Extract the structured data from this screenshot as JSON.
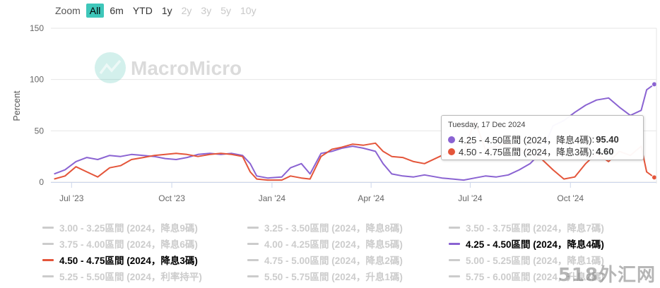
{
  "zoom": {
    "label": "Zoom",
    "buttons": [
      {
        "label": "All",
        "state": "active"
      },
      {
        "label": "6m",
        "state": "normal"
      },
      {
        "label": "YTD",
        "state": "normal"
      },
      {
        "label": "1y",
        "state": "normal"
      },
      {
        "label": "2y",
        "state": "disabled"
      },
      {
        "label": "3y",
        "state": "disabled"
      },
      {
        "label": "5y",
        "state": "disabled"
      },
      {
        "label": "10y",
        "state": "disabled"
      }
    ]
  },
  "watermark": "MacroMicro",
  "corner_watermark": "518外汇网",
  "tooltip": {
    "date": "Tuesday, 17 Dec 2024",
    "rows": [
      {
        "label": "4.25 - 4.50區間 (2024，降息4碼)",
        "value": "95.40",
        "color": "#8a63d2"
      },
      {
        "label": "4.50 - 4.75區間 (2024，降息3碼)",
        "value": "4.60",
        "color": "#e4553a"
      }
    ]
  },
  "legend": [
    {
      "label": "3.00 - 3.25區間 (2024，降息9碼)",
      "visible": false,
      "color": "#cccccc"
    },
    {
      "label": "3.25 - 3.50區間 (2024，降息8碼)",
      "visible": false,
      "color": "#cccccc"
    },
    {
      "label": "3.50 - 3.75區間 (2024，降息7碼)",
      "visible": false,
      "color": "#cccccc"
    },
    {
      "label": "3.75 - 4.00區間 (2024，降息6碼)",
      "visible": false,
      "color": "#cccccc"
    },
    {
      "label": "4.00 - 4.25區間 (2024，降息5碼)",
      "visible": false,
      "color": "#cccccc"
    },
    {
      "label": "4.25 - 4.50區間 (2024，降息4碼)",
      "visible": true,
      "color": "#8a63d2"
    },
    {
      "label": "4.50 - 4.75區間 (2024，降息3碼)",
      "visible": true,
      "color": "#e4553a"
    },
    {
      "label": "4.75 - 5.00區間 (2024，降息2碼)",
      "visible": false,
      "color": "#cccccc"
    },
    {
      "label": "5.00 - 5.25區間 (2024，降息1碼)",
      "visible": false,
      "color": "#cccccc"
    },
    {
      "label": "5.25 - 5.50區間 (2024，利率持平)",
      "visible": false,
      "color": "#cccccc"
    },
    {
      "label": "5.50 - 5.75區間 (2024，升息1碼)",
      "visible": false,
      "color": "#cccccc"
    },
    {
      "label": "5.75 - 6.00區間 (2024，升息2碼)",
      "visible": false,
      "color": "#cccccc"
    }
  ],
  "chart_data": {
    "type": "line",
    "ylabel": "Percent",
    "ylim": [
      0,
      150
    ],
    "yticks": [
      0,
      50,
      100,
      150
    ],
    "xlim": [
      "2023-06-12",
      "2024-12-19"
    ],
    "xticks": [
      {
        "date": "2023-07-01",
        "label": "Jul '23"
      },
      {
        "date": "2023-10-01",
        "label": "Oct '23"
      },
      {
        "date": "2024-01-01",
        "label": "Jan '24"
      },
      {
        "date": "2024-04-01",
        "label": "Apr '24"
      },
      {
        "date": "2024-07-01",
        "label": "Jul '24"
      },
      {
        "date": "2024-10-01",
        "label": "Oct '24"
      }
    ],
    "grid": true,
    "series": [
      {
        "name": "4.25 - 4.50區間 (2024，降息4碼)",
        "color": "#8a63d2",
        "points": [
          [
            "2023-06-15",
            8
          ],
          [
            "2023-06-25",
            12
          ],
          [
            "2023-07-05",
            20
          ],
          [
            "2023-07-15",
            24
          ],
          [
            "2023-07-25",
            22
          ],
          [
            "2023-08-05",
            26
          ],
          [
            "2023-08-15",
            25
          ],
          [
            "2023-08-25",
            27
          ],
          [
            "2023-09-05",
            26
          ],
          [
            "2023-09-15",
            25
          ],
          [
            "2023-09-25",
            23
          ],
          [
            "2023-10-05",
            22
          ],
          [
            "2023-10-15",
            24
          ],
          [
            "2023-10-25",
            27
          ],
          [
            "2023-11-05",
            28
          ],
          [
            "2023-11-15",
            27
          ],
          [
            "2023-11-25",
            28
          ],
          [
            "2023-12-05",
            26
          ],
          [
            "2023-12-12",
            18
          ],
          [
            "2023-12-18",
            6
          ],
          [
            "2023-12-28",
            4
          ],
          [
            "2024-01-10",
            5
          ],
          [
            "2024-01-18",
            14
          ],
          [
            "2024-01-28",
            18
          ],
          [
            "2024-02-05",
            8
          ],
          [
            "2024-02-15",
            28
          ],
          [
            "2024-02-25",
            30
          ],
          [
            "2024-03-05",
            33
          ],
          [
            "2024-03-15",
            35
          ],
          [
            "2024-03-25",
            33
          ],
          [
            "2024-04-05",
            30
          ],
          [
            "2024-04-12",
            18
          ],
          [
            "2024-04-20",
            8
          ],
          [
            "2024-04-30",
            6
          ],
          [
            "2024-05-10",
            5
          ],
          [
            "2024-05-20",
            7
          ],
          [
            "2024-06-05",
            4
          ],
          [
            "2024-06-15",
            3
          ],
          [
            "2024-06-25",
            2
          ],
          [
            "2024-07-05",
            4
          ],
          [
            "2024-07-15",
            6
          ],
          [
            "2024-07-25",
            5
          ],
          [
            "2024-08-05",
            7
          ],
          [
            "2024-08-15",
            12
          ],
          [
            "2024-08-25",
            18
          ],
          [
            "2024-09-05",
            30
          ],
          [
            "2024-09-15",
            55
          ],
          [
            "2024-09-25",
            60
          ],
          [
            "2024-10-05",
            68
          ],
          [
            "2024-10-15",
            75
          ],
          [
            "2024-10-25",
            80
          ],
          [
            "2024-11-05",
            82
          ],
          [
            "2024-11-15",
            73
          ],
          [
            "2024-11-25",
            65
          ],
          [
            "2024-12-05",
            70
          ],
          [
            "2024-12-10",
            90
          ],
          [
            "2024-12-17",
            95.4
          ]
        ]
      },
      {
        "name": "4.50 - 4.75區間 (2024，降息3碼)",
        "color": "#e4553a",
        "points": [
          [
            "2023-06-15",
            3
          ],
          [
            "2023-06-25",
            6
          ],
          [
            "2023-07-05",
            15
          ],
          [
            "2023-07-15",
            10
          ],
          [
            "2023-07-25",
            5
          ],
          [
            "2023-08-05",
            14
          ],
          [
            "2023-08-15",
            16
          ],
          [
            "2023-08-25",
            22
          ],
          [
            "2023-09-05",
            24
          ],
          [
            "2023-09-15",
            26
          ],
          [
            "2023-09-25",
            27
          ],
          [
            "2023-10-05",
            28
          ],
          [
            "2023-10-15",
            27
          ],
          [
            "2023-10-25",
            25
          ],
          [
            "2023-11-05",
            27
          ],
          [
            "2023-11-15",
            28
          ],
          [
            "2023-11-25",
            27
          ],
          [
            "2023-12-05",
            25
          ],
          [
            "2023-12-12",
            10
          ],
          [
            "2023-12-18",
            3
          ],
          [
            "2023-12-28",
            2
          ],
          [
            "2024-01-10",
            2
          ],
          [
            "2024-01-18",
            6
          ],
          [
            "2024-01-28",
            4
          ],
          [
            "2024-02-05",
            3
          ],
          [
            "2024-02-15",
            25
          ],
          [
            "2024-02-25",
            32
          ],
          [
            "2024-03-05",
            34
          ],
          [
            "2024-03-15",
            37
          ],
          [
            "2024-03-25",
            36
          ],
          [
            "2024-04-05",
            38
          ],
          [
            "2024-04-12",
            30
          ],
          [
            "2024-04-20",
            25
          ],
          [
            "2024-04-30",
            24
          ],
          [
            "2024-05-10",
            20
          ],
          [
            "2024-05-20",
            18
          ],
          [
            "2024-06-05",
            26
          ],
          [
            "2024-06-15",
            30
          ],
          [
            "2024-06-25",
            28
          ],
          [
            "2024-07-05",
            60
          ],
          [
            "2024-07-15",
            32
          ],
          [
            "2024-07-25",
            35
          ],
          [
            "2024-08-05",
            38
          ],
          [
            "2024-08-15",
            32
          ],
          [
            "2024-08-25",
            28
          ],
          [
            "2024-09-05",
            22
          ],
          [
            "2024-09-15",
            12
          ],
          [
            "2024-09-25",
            3
          ],
          [
            "2024-10-05",
            5
          ],
          [
            "2024-10-15",
            18
          ],
          [
            "2024-10-25",
            28
          ],
          [
            "2024-11-05",
            20
          ],
          [
            "2024-11-15",
            30
          ],
          [
            "2024-11-25",
            26
          ],
          [
            "2024-12-05",
            35
          ],
          [
            "2024-12-10",
            10
          ],
          [
            "2024-12-17",
            4.6
          ]
        ]
      }
    ]
  }
}
